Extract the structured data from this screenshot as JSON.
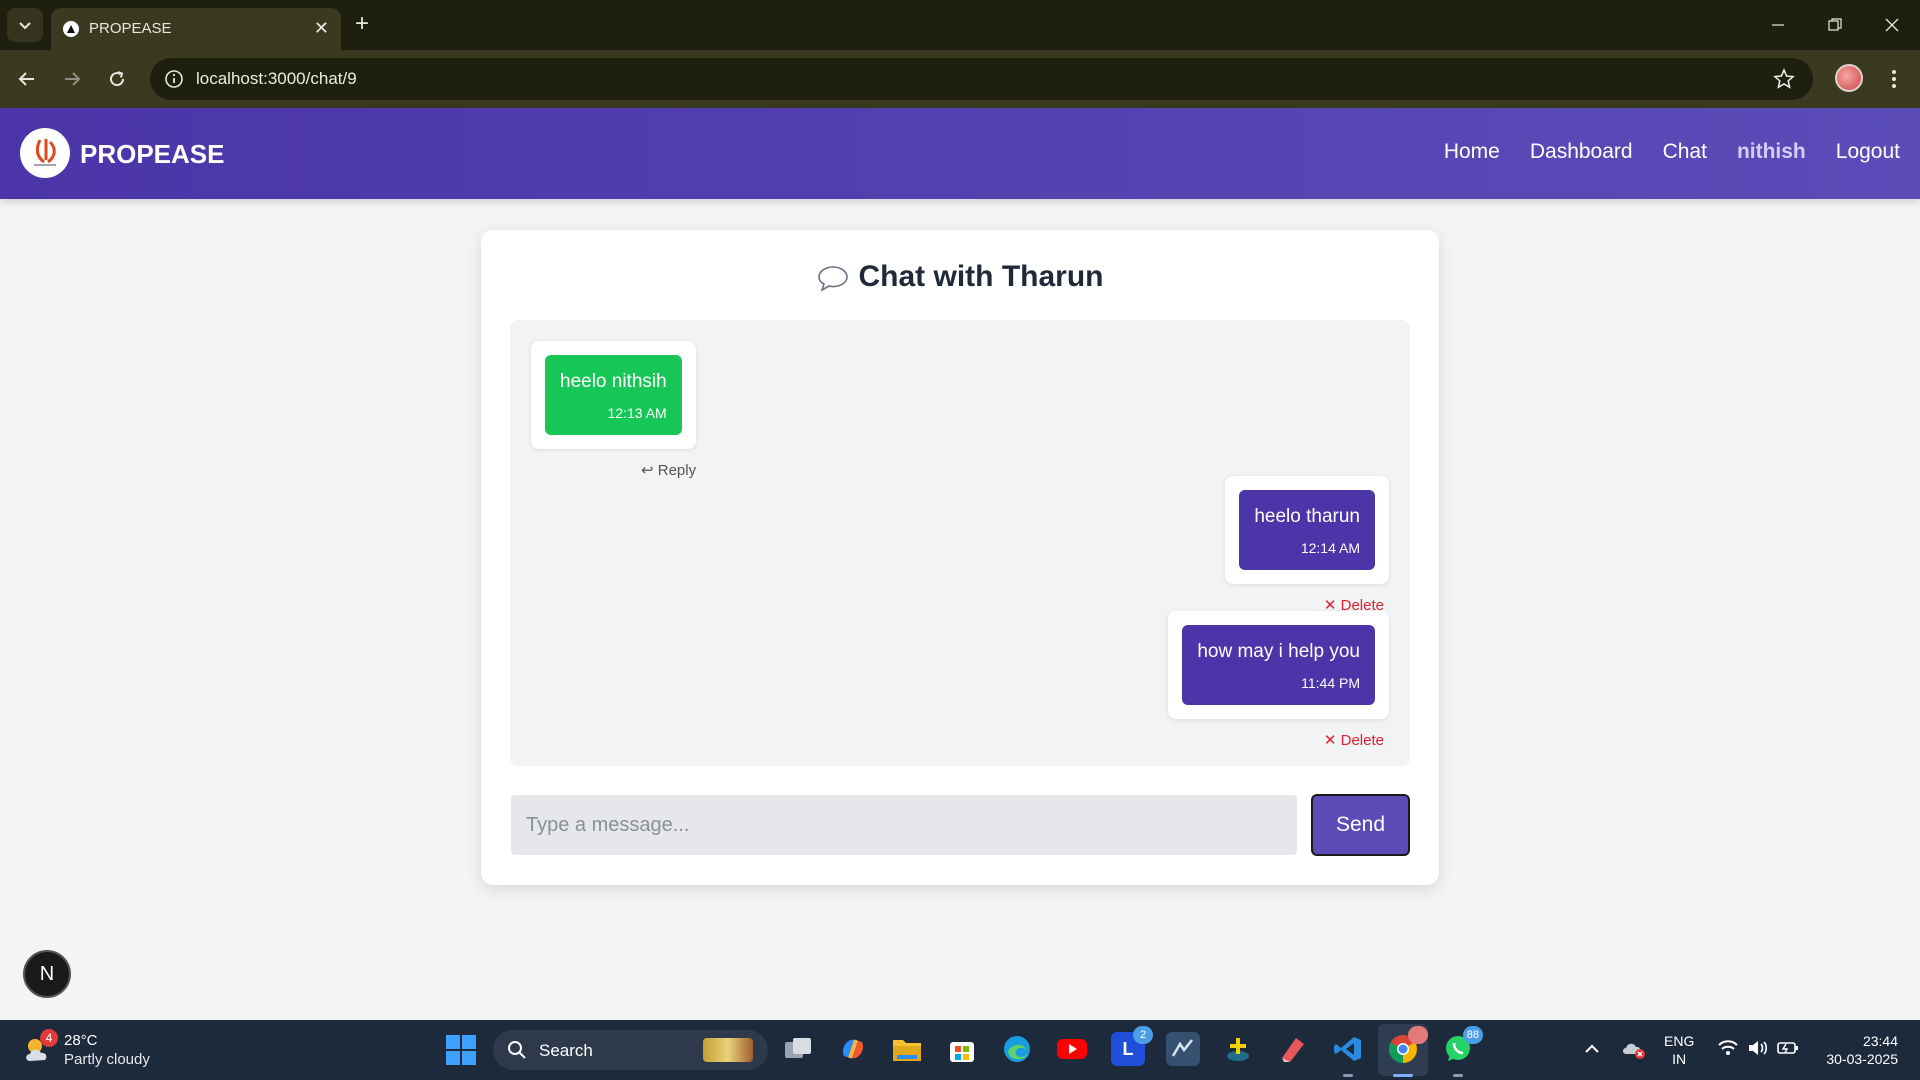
{
  "browser": {
    "tab_title": "PROPEASE",
    "url": "localhost:3000/chat/9"
  },
  "app": {
    "brand": "PROPEASE",
    "nav": {
      "home": "Home",
      "dashboard": "Dashboard",
      "chat": "Chat",
      "user": "nithish",
      "logout": "Logout"
    }
  },
  "chat": {
    "title": "Chat with Tharun",
    "messages": [
      {
        "direction": "received",
        "text": "heelo nithsih",
        "time": "12:13 AM",
        "action": "↩ Reply"
      },
      {
        "direction": "sent",
        "text": "heelo tharun",
        "time": "12:14 AM",
        "action": "✕ Delete"
      },
      {
        "direction": "sent",
        "text": "how may i help you",
        "time": "11:44 PM",
        "action": "✕ Delete"
      }
    ],
    "input_placeholder": "Type a message...",
    "send_label": "Send"
  },
  "dev_badge": "N",
  "taskbar": {
    "weather_badge": "4",
    "weather_temp": "28°C",
    "weather_condition": "Partly cloudy",
    "search_label": "Search",
    "lens_badge": "2",
    "whatsapp_badge": "88",
    "lang_line1": "ENG",
    "lang_line2": "IN",
    "time": "23:44",
    "date": "30-03-2025"
  },
  "colors": {
    "brand_purple": "#4b35a8",
    "received_green": "#16c758",
    "delete_red": "#e0202f"
  }
}
